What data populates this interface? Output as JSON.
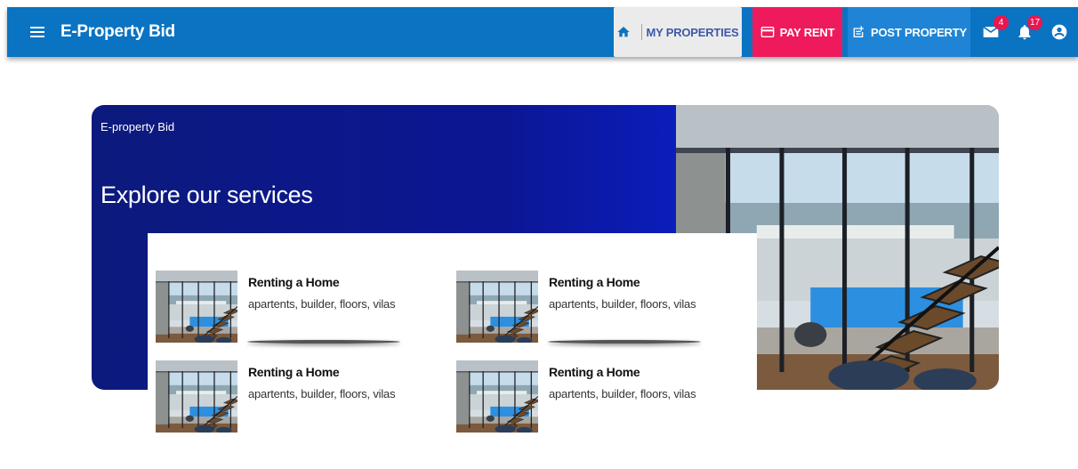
{
  "appbar": {
    "title": "E-Property Bid",
    "menu_icon": "hamburger-menu-icon",
    "background": "#0a73c2",
    "my_properties": {
      "label": "MY PROPERTIES",
      "icon": "home-icon"
    },
    "pay_rent": {
      "label": "PAY RENT",
      "icon": "credit-card-icon",
      "color": "#ef1a5b"
    },
    "post_property": {
      "label": "POST PROPERTY",
      "icon": "post-add-icon"
    },
    "mail": {
      "icon": "mail-icon",
      "count": "4"
    },
    "notifications": {
      "icon": "bell-icon",
      "count": "17"
    },
    "account": {
      "icon": "account-circle-icon"
    }
  },
  "hero": {
    "kicker": "E-property Bid",
    "title": "Explore our services",
    "image": "modern-house-staircase-pool-photo"
  },
  "services": [
    {
      "title": "Renting a Home",
      "description": "apartents, builder, floors, vilas"
    },
    {
      "title": "Renting a Home",
      "description": "apartents, builder, floors, vilas"
    },
    {
      "title": "Renting a Home",
      "description": "apartents, builder, floors, vilas"
    },
    {
      "title": "Renting a Home",
      "description": "apartents, builder, floors, vilas"
    }
  ]
}
